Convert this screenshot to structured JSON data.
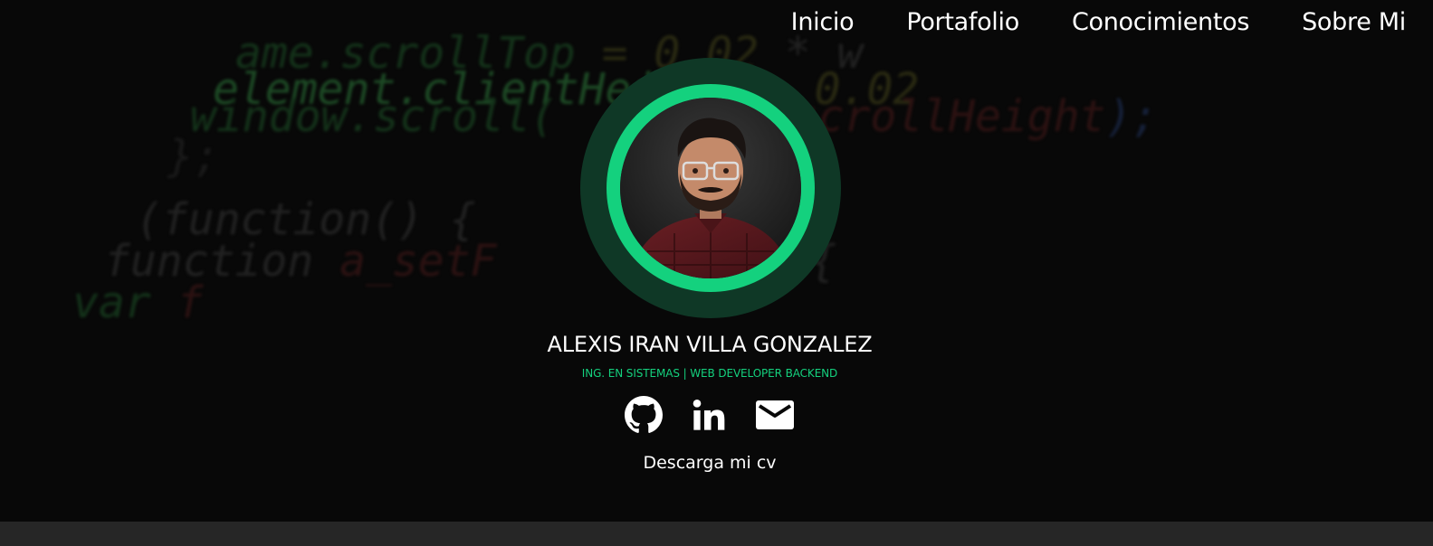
{
  "nav": {
    "items": [
      "Inicio",
      "Portafolio",
      "Conocimientos",
      "Sobre Mi"
    ]
  },
  "profile": {
    "name": "ALEXIS IRAN VILLA GONZALEZ",
    "subtitle": "ING. EN SISTEMAS | WEB DEVELOPER BACKEND",
    "cv_link": "Descarga mi cv"
  },
  "social": {
    "icons": [
      "github-icon",
      "linkedin-icon",
      "mail-icon"
    ]
  },
  "background_code": [
    "  ame.scrollTop = 0.02 * w",
    " element.client  ht + 0.02",
    "window.scroll(   scrollHeight);",
    "};",
    "(function() {",
    "function a_setF    () {",
    "var f"
  ],
  "colors": {
    "accent": "#14d17e",
    "ring_outer": "#0f3826",
    "background": "#080808",
    "footer": "#262626",
    "text": "#ffffff"
  }
}
